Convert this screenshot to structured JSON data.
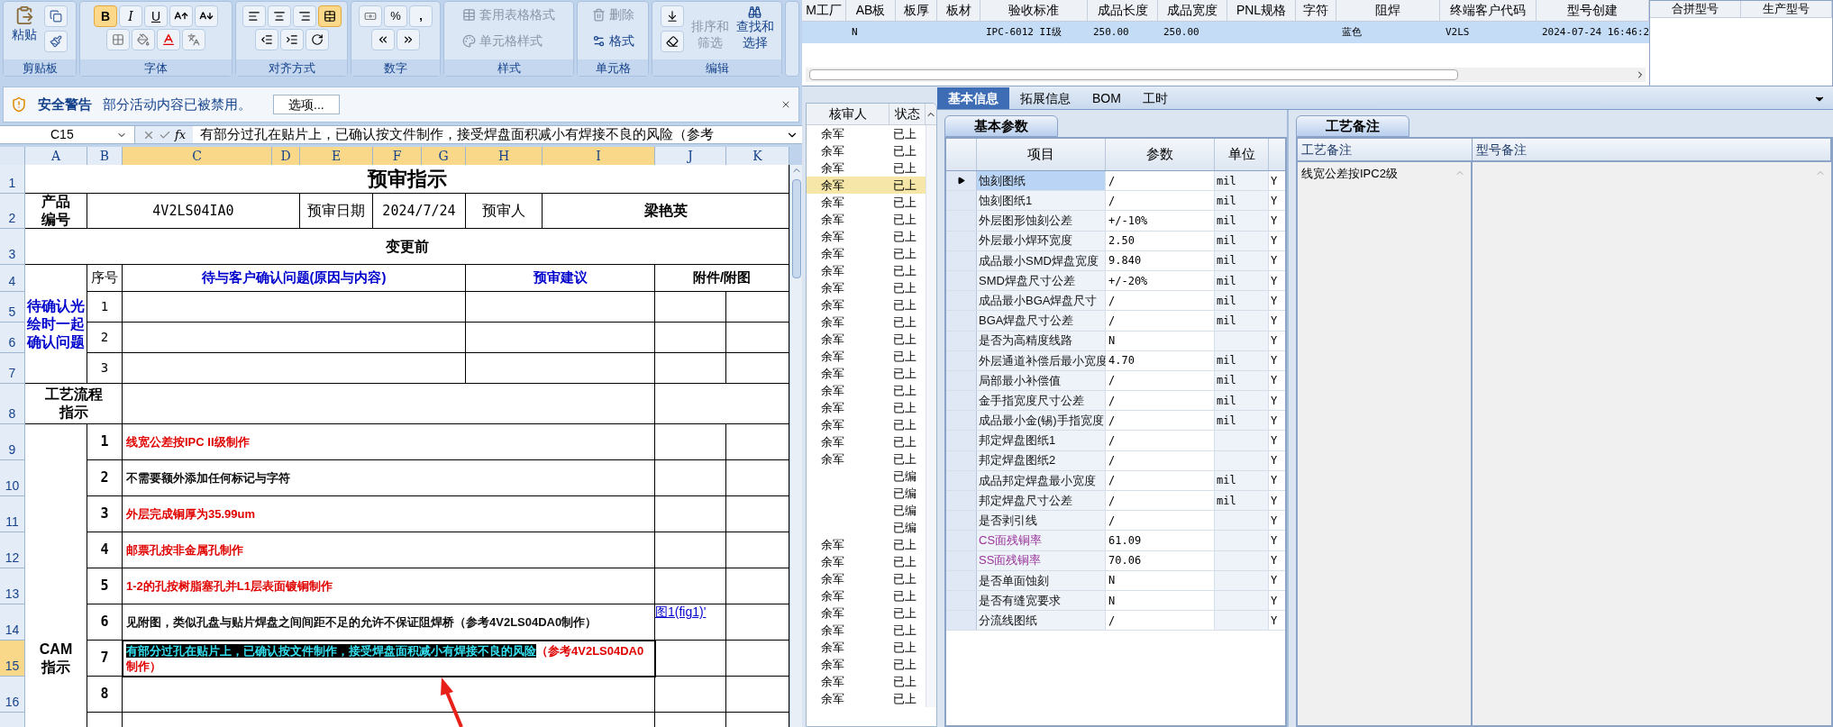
{
  "excel": {
    "ribbon": {
      "paste": "粘贴",
      "bold": "B",
      "italic": "I",
      "underline": "U",
      "percent": "%",
      "comma": ",",
      "merge_center_on": true,
      "styles": [
        {
          "label": "套用表格格式",
          "disabled": true
        },
        {
          "label": "单元格样式",
          "disabled": true
        }
      ],
      "cells": [
        {
          "label": "删除",
          "disabled": true
        },
        {
          "label": "格式",
          "disabled": false
        }
      ],
      "editing": [
        {
          "label": "排序和筛选",
          "disabled": true
        },
        {
          "label": "查找和选择",
          "disabled": false
        }
      ],
      "groups": [
        "剪贴板",
        "字体",
        "对齐方式",
        "数字",
        "样式",
        "单元格",
        "编辑"
      ]
    },
    "security_bar": {
      "title": "安全警告",
      "message": "部分活动内容已被禁用。",
      "button": "选项..."
    },
    "formula_bar": {
      "name_box": "C15",
      "fx": "fx",
      "formula": "有部分过孔在贴片上，已确认按文件制作，接受焊盘面积减小有焊接不良的风险（参考"
    },
    "columns": [
      {
        "label": "A",
        "selected": false
      },
      {
        "label": "B",
        "selected": false
      },
      {
        "label": "C",
        "selected": true
      },
      {
        "label": "D",
        "selected": true
      },
      {
        "label": "E",
        "selected": true
      },
      {
        "label": "F",
        "selected": true
      },
      {
        "label": "G",
        "selected": true
      },
      {
        "label": "H",
        "selected": true
      },
      {
        "label": "I",
        "selected": true
      },
      {
        "label": "J",
        "selected": false
      },
      {
        "label": "K",
        "selected": false
      }
    ],
    "rows": [
      {
        "label": "1",
        "selected": false
      },
      {
        "label": "2",
        "selected": false
      },
      {
        "label": "3",
        "selected": false
      },
      {
        "label": "4",
        "selected": false
      },
      {
        "label": "5",
        "selected": false
      },
      {
        "label": "6",
        "selected": false
      },
      {
        "label": "7",
        "selected": false
      },
      {
        "label": "8",
        "selected": false
      },
      {
        "label": "9",
        "selected": false
      },
      {
        "label": "10",
        "selected": false
      },
      {
        "label": "11",
        "selected": false
      },
      {
        "label": "12",
        "selected": false
      },
      {
        "label": "13",
        "selected": false
      },
      {
        "label": "14",
        "selected": false
      },
      {
        "label": "15",
        "selected": true
      },
      {
        "label": "16",
        "selected": false
      }
    ],
    "title": "预审指示",
    "header": {
      "product_label": "产品编号",
      "product_code": "4V2LS04IA0",
      "date_label": "预审日期",
      "date": "2024/7/24",
      "reviewer_label": "预审人",
      "reviewer": "梁艳英"
    },
    "section_label": "变更前",
    "confirm": {
      "label": "待确认光绘时一起确认问题",
      "columns": [
        "序号",
        "待与客户确认问题(原因与内容)",
        "预审建议",
        "附件/附图"
      ],
      "rows": [
        "1",
        "2",
        "3"
      ]
    },
    "process_label": "工艺流程指示",
    "cam": {
      "label": "CAM指示",
      "rows": [
        {
          "number": "1",
          "text": "线宽公差按IPC  II级制作",
          "color": "#e00000"
        },
        {
          "number": "2",
          "text": "不需要额外添加任何标记与字符"
        },
        {
          "number": "3",
          "text": "外层完成铜厚为35.99um",
          "color": "#e00000"
        },
        {
          "number": "4",
          "text": "邮票孔按非金属孔制作",
          "color": "#e00000"
        },
        {
          "number": "5",
          "text": "1-2的孔按树脂塞孔并L1层表面镀铜制作",
          "color": "#e00000"
        },
        {
          "number": "6",
          "text": "见附图，类似孔盘与贴片焊盘之间间距不足的允许不保证阻焊桥（参考4V2LS04DA0制作）",
          "attachment": "图1(fig1)'"
        },
        {
          "number": "7",
          "highlight": "有部分过孔在贴片上，已确认按文件制作，接受焊盘面积减小有焊接不良的风险",
          "text": "（参考4V2LS04DA0制作）",
          "color": "#e00000"
        },
        {
          "number": "8"
        }
      ]
    }
  },
  "top_grid": {
    "columns": [
      "M工厂",
      "AB板",
      "板厚",
      "板材",
      "验收标准",
      "成品长度",
      "成品宽度",
      "PNL规格",
      "字符",
      "阻焊",
      "终端客户代码",
      "型号创建"
    ],
    "rows": [
      {
        "selected": true,
        "cells": [
          "",
          "N",
          "",
          "",
          "IPC-6012 II级",
          "250.00",
          "250.00",
          "",
          "",
          "蓝色",
          "V2LS",
          "2024-07-24 16:46:2"
        ]
      }
    ]
  },
  "side_grid": {
    "columns": [
      "合拼型号",
      "生产型号"
    ]
  },
  "list": {
    "columns": [
      "核审人",
      "状态"
    ],
    "rows": [
      {
        "reviewer": "余军",
        "status": "已上",
        "selected": false
      },
      {
        "reviewer": "余军",
        "status": "已上",
        "selected": false
      },
      {
        "reviewer": "余军",
        "status": "已上",
        "selected": false
      },
      {
        "reviewer": "余军",
        "status": "已上",
        "selected": true
      },
      {
        "reviewer": "余军",
        "status": "已上",
        "selected": false
      },
      {
        "reviewer": "余军",
        "status": "已上",
        "selected": false
      },
      {
        "reviewer": "余军",
        "status": "已上",
        "selected": false
      },
      {
        "reviewer": "余军",
        "status": "已上",
        "selected": false
      },
      {
        "reviewer": "余军",
        "status": "已上",
        "selected": false
      },
      {
        "reviewer": "余军",
        "status": "已上",
        "selected": false
      },
      {
        "reviewer": "余军",
        "status": "已上",
        "selected": false
      },
      {
        "reviewer": "余军",
        "status": "已上",
        "selected": false
      },
      {
        "reviewer": "余军",
        "status": "已上",
        "selected": false
      },
      {
        "reviewer": "余军",
        "status": "已上",
        "selected": false
      },
      {
        "reviewer": "余军",
        "status": "已上",
        "selected": false
      },
      {
        "reviewer": "余军",
        "status": "已上",
        "selected": false
      },
      {
        "reviewer": "余军",
        "status": "已上",
        "selected": false
      },
      {
        "reviewer": "余军",
        "status": "已上",
        "selected": false
      },
      {
        "reviewer": "余军",
        "status": "已上",
        "selected": false
      },
      {
        "reviewer": "余军",
        "status": "已上",
        "selected": false
      },
      {
        "status": "已编",
        "selected": false
      },
      {
        "status": "已编",
        "selected": false
      },
      {
        "status": "已编",
        "selected": false
      },
      {
        "status": "已编",
        "selected": false
      },
      {
        "reviewer": "余军",
        "status": "已上",
        "selected": false
      },
      {
        "reviewer": "余军",
        "status": "已上",
        "selected": false
      },
      {
        "reviewer": "余军",
        "status": "已上",
        "selected": false
      },
      {
        "reviewer": "余军",
        "status": "已上",
        "selected": false
      },
      {
        "reviewer": "余军",
        "status": "已上",
        "selected": false
      },
      {
        "reviewer": "余军",
        "status": "已上",
        "selected": false
      },
      {
        "reviewer": "余军",
        "status": "已上",
        "selected": false
      },
      {
        "reviewer": "余军",
        "status": "已上",
        "selected": false
      },
      {
        "reviewer": "余军",
        "status": "已上",
        "selected": false
      },
      {
        "reviewer": "余军",
        "status": "已上",
        "selected": false
      }
    ]
  },
  "tabs": [
    {
      "label": "基本信息",
      "selected": true
    },
    {
      "label": "拓展信息",
      "selected": false
    },
    {
      "label": "BOM",
      "selected": false
    },
    {
      "label": "工时",
      "selected": false
    }
  ],
  "params": {
    "tab": "基本参数",
    "columns": [
      "项目",
      "参数",
      "单位"
    ],
    "rows": [
      {
        "name": "蚀刻图纸",
        "value": "/",
        "unit": "mil",
        "flag": "Y",
        "selected": true
      },
      {
        "name": "蚀刻图纸1",
        "value": "/",
        "unit": "mil",
        "flag": "Y",
        "selected": false
      },
      {
        "name": "外层图形蚀刻公差",
        "value": "+/-10%",
        "unit": "mil",
        "flag": "Y",
        "selected": false
      },
      {
        "name": "外层最小焊环宽度",
        "value": "2.50",
        "unit": "mil",
        "flag": "Y",
        "selected": false
      },
      {
        "name": "成品最小SMD焊盘宽度",
        "value": "9.840",
        "unit": "mil",
        "flag": "Y",
        "selected": false
      },
      {
        "name": "SMD焊盘尺寸公差",
        "value": "+/-20%",
        "unit": "mil",
        "flag": "Y",
        "selected": false
      },
      {
        "name": "成品最小BGA焊盘尺寸",
        "value": "/",
        "unit": "mil",
        "flag": "Y",
        "selected": false
      },
      {
        "name": "BGA焊盘尺寸公差",
        "value": "/",
        "unit": "mil",
        "flag": "Y",
        "selected": false
      },
      {
        "name": "是否为高精度线路",
        "value": "N",
        "flag": "Y",
        "selected": false
      },
      {
        "name": "外层通道补偿后最小宽度",
        "value": "4.70",
        "unit": "mil",
        "flag": "Y",
        "selected": false
      },
      {
        "name": "局部最小补偿值",
        "value": "/",
        "unit": "mil",
        "flag": "Y",
        "selected": false
      },
      {
        "name": "金手指宽度尺寸公差",
        "value": "/",
        "unit": "mil",
        "flag": "Y",
        "selected": false
      },
      {
        "name": "成品最小金(锡)手指宽度",
        "value": "/",
        "unit": "mil",
        "flag": "Y",
        "selected": false
      },
      {
        "name": "邦定焊盘图纸1",
        "value": "/",
        "flag": "Y",
        "selected": false
      },
      {
        "name": "邦定焊盘图纸2",
        "value": "/",
        "flag": "Y",
        "selected": false
      },
      {
        "name": "成品邦定焊盘最小宽度",
        "value": "/",
        "unit": "mil",
        "flag": "Y",
        "selected": false
      },
      {
        "name": "邦定焊盘尺寸公差",
        "value": "/",
        "unit": "mil",
        "flag": "Y",
        "selected": false
      },
      {
        "name": "是否剥引线",
        "value": "/",
        "flag": "Y",
        "selected": false
      },
      {
        "name": "CS面残铜率",
        "value": "61.09",
        "flag": "Y",
        "selected": false,
        "color": "#993399"
      },
      {
        "name": "SS面残铜率",
        "value": "70.06",
        "flag": "Y",
        "selected": false,
        "color": "#993399"
      },
      {
        "name": "是否单面蚀刻",
        "value": "N",
        "flag": "Y",
        "selected": false
      },
      {
        "name": "是否有缝宽要求",
        "value": "N",
        "flag": "Y",
        "selected": false
      },
      {
        "name": "分流线图纸",
        "value": "/",
        "flag": "Y",
        "selected": false
      }
    ]
  },
  "notes": {
    "tab": "工艺备注",
    "columns": [
      "工艺备注",
      "型号备注"
    ],
    "process_note": "线宽公差按IPC2级"
  }
}
